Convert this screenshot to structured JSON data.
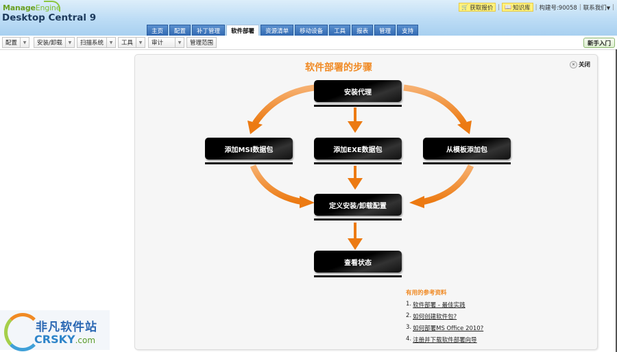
{
  "header": {
    "logo_brand": "Manage",
    "logo_brand_suffix": "Engine",
    "product_name": "Desktop Central 9",
    "top_links": {
      "get_quote": "获取报价",
      "knowledge_base": "知识库",
      "build_number": "构建号:90058",
      "contact_us": "联系我们"
    },
    "nav_tabs": [
      {
        "label": "主页",
        "active": false
      },
      {
        "label": "配置",
        "active": false
      },
      {
        "label": "补丁管理",
        "active": false
      },
      {
        "label": "软件部署",
        "active": true
      },
      {
        "label": "资源清单",
        "active": false
      },
      {
        "label": "移动设备",
        "active": false
      },
      {
        "label": "工具",
        "active": false
      },
      {
        "label": "报表",
        "active": false
      },
      {
        "label": "管理",
        "active": false
      },
      {
        "label": "支持",
        "active": false
      }
    ]
  },
  "toolbar": {
    "menus": [
      {
        "label": "配置",
        "has_dropdown": true
      },
      {
        "label": "安装/卸载",
        "has_dropdown": true
      },
      {
        "label": "扫描系统",
        "has_dropdown": true
      },
      {
        "label": "工具",
        "has_dropdown": true
      },
      {
        "label": "审计",
        "has_dropdown": true
      },
      {
        "label": "管理范围",
        "has_dropdown": false
      }
    ],
    "quick_start": "新手入门"
  },
  "panel": {
    "title": "软件部署的步骤",
    "close_label": "关闭",
    "steps": {
      "install_agent": "安装代理",
      "add_msi": "添加MSI数据包",
      "add_exe": "添加EXE数据包",
      "add_template": "从模板添加包",
      "define_config": "定义安装/卸载配置",
      "view_status": "查看状态"
    },
    "accent_color": "#f08a24",
    "references": {
      "title": "有用的参考资料",
      "items": [
        {
          "num": "1.",
          "label": "软件部署 - 最佳实践"
        },
        {
          "num": "2.",
          "label": "如何创建软件包?"
        },
        {
          "num": "3.",
          "label": "如何部署MS Office 2010?"
        },
        {
          "num": "4.",
          "label": "注册并下载软件部署向导"
        }
      ]
    }
  },
  "watermark": {
    "cn": "非凡软件站",
    "en": "CRSKY",
    "en_suffix": ".com"
  }
}
